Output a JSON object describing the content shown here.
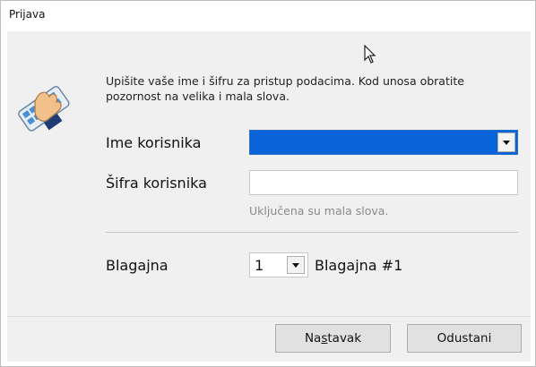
{
  "window": {
    "title": "Prijava"
  },
  "intro": {
    "text": "Upišite vaše ime i šifru za pristup podacima. Kod unosa obratite pozornost na velika i mala slova."
  },
  "form": {
    "user_label": "Ime korisnika",
    "user_value": "",
    "password_label": "Šifra korisnika",
    "password_value": "",
    "caps_hint": "Uključena su mala slova.",
    "register_label": "Blagajna",
    "register_value": "1",
    "register_name": "Blagajna #1"
  },
  "buttons": {
    "next_pre": "Na",
    "next_mnemonic": "s",
    "next_post": "tavak",
    "cancel_label": "Odustani"
  },
  "icons": {
    "app_icon": "login-keyboard-hand-icon",
    "cursor": "mouse-pointer-icon",
    "dropdown": "chevron-down-icon"
  },
  "colors": {
    "selection_blue": "#0a64d9",
    "dialog_background": "#f0f0f0",
    "hint_gray": "#8a8a8a"
  }
}
